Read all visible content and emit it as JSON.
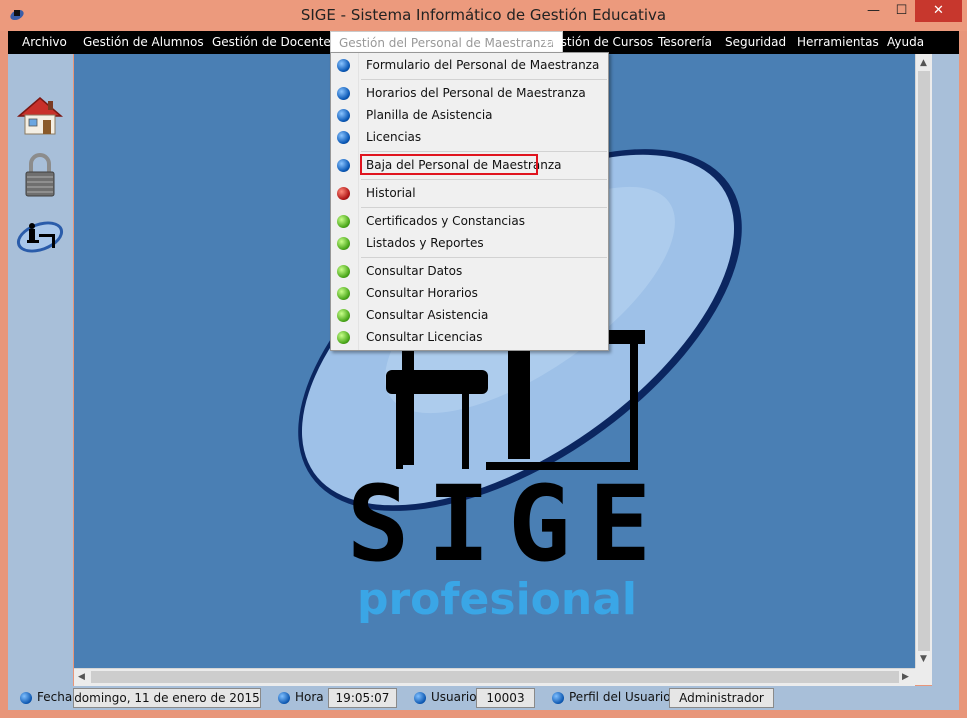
{
  "window": {
    "title": "SIGE - Sistema Informático de Gestión Educativa",
    "min_glyph": "—",
    "max_glyph": "☐",
    "close_glyph": "✕"
  },
  "menubar": {
    "items": [
      {
        "label": "Archivo"
      },
      {
        "label": "Gestión de  Alumnos"
      },
      {
        "label": "Gestión de Docentes"
      },
      {
        "label": "Gestión del Personal de Maestranza",
        "active": true
      },
      {
        "label": "Gestión de Cursos"
      },
      {
        "label": "Tesorería"
      },
      {
        "label": "Seguridad"
      },
      {
        "label": "Herramientas"
      },
      {
        "label": "Ayuda"
      }
    ]
  },
  "dropdown": {
    "items": [
      {
        "label": "Formulario del Personal de Maestranza",
        "dot": "blue"
      },
      {
        "label": "Horarios del Personal de Maestranza",
        "dot": "blue"
      },
      {
        "label": "Planilla de Asistencia",
        "dot": "blue"
      },
      {
        "label": "Licencias",
        "dot": "blue"
      },
      {
        "label": "Baja del Personal de Maestranza",
        "dot": "blue",
        "highlighted": true
      },
      {
        "label": "Historial",
        "dot": "red"
      },
      {
        "label": "Certificados y Constancias",
        "dot": "green"
      },
      {
        "label": "Listados y Reportes",
        "dot": "green"
      },
      {
        "label": "Consultar Datos",
        "dot": "green"
      },
      {
        "label": "Consultar Horarios",
        "dot": "green"
      },
      {
        "label": "Consultar Asistencia",
        "dot": "green"
      },
      {
        "label": "Consultar Licencias",
        "dot": "green"
      }
    ]
  },
  "sidebar": {
    "icons": [
      "home-icon",
      "padlock-icon",
      "desk-person-icon"
    ]
  },
  "logo": {
    "wordmark": "SIGE",
    "sub": "profesional"
  },
  "status": {
    "fecha_label": "Fecha",
    "fecha_value": "domingo, 11 de enero de 2015",
    "hora_label": "Hora",
    "hora_value": "19:05:07",
    "usuario_label": "Usuario",
    "usuario_value": "10003",
    "perfil_label": "Perfil del Usuario",
    "perfil_value": "Administrador"
  },
  "colors": {
    "desktop": "#4a7fb4",
    "menubar": "#000000",
    "highlight": "#e0141e"
  }
}
